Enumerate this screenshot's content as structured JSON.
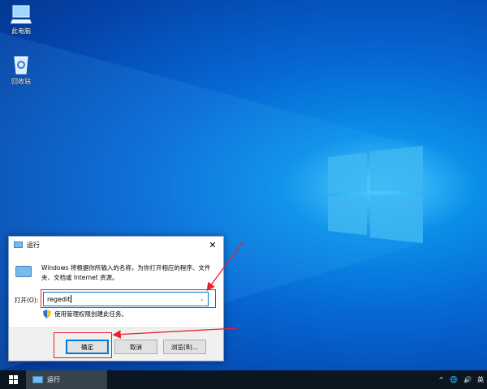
{
  "desktop": {
    "icons": [
      {
        "label": "此电脑",
        "icon": "computer-icon"
      },
      {
        "label": "回收站",
        "icon": "recycle-bin-icon"
      }
    ]
  },
  "dialog": {
    "title": "运行",
    "description": "Windows 将根据你所输入的名称，为你打开相应的程序、文件夹、文档或 Internet 资源。",
    "open_label": "打开(O):",
    "input_value": "regedit",
    "admin_note": "使用管理权限创建此任务。",
    "ok": "确定",
    "cancel": "取消",
    "browse": "浏览(B)..."
  },
  "annotation_color": "#e8212c",
  "taskbar": {
    "task_label": "运行",
    "tray": {
      "chevron": "^",
      "ime": "英"
    }
  }
}
